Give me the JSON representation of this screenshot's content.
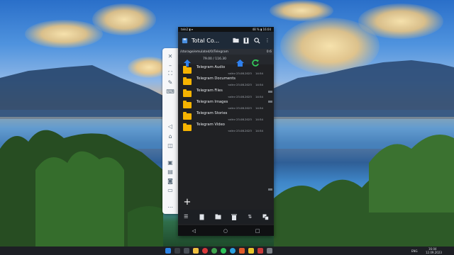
{
  "phone_status": {
    "left": "tele2 ▮ ▾",
    "right": "48 % ▮ 16:04"
  },
  "app": {
    "title": "Total Co...",
    "path": "/storage/emulated/0/Telegram",
    "path_right": "0:6",
    "space_info": "79.00 / 116.30"
  },
  "files": [
    {
      "name": "Telegram Audio",
      "type": "<dir>",
      "date": "23.08.2023",
      "time": "14:54"
    },
    {
      "name": "Telegram Documents",
      "type": "<dir>",
      "date": "23.08.2023",
      "time": "14:54"
    },
    {
      "name": "Telegram Files",
      "type": "<dir>",
      "date": "23.08.2023",
      "time": "14:54"
    },
    {
      "name": "Telegram Images",
      "type": "<dir>",
      "date": "23.08.2023",
      "time": "14:54"
    },
    {
      "name": "Telegram Stories",
      "type": "<dir>",
      "date": "23.08.2023",
      "time": "14:54"
    },
    {
      "name": "Telegram Video",
      "type": "<dir>",
      "date": "23.08.2023",
      "time": "14:54"
    }
  ],
  "taskbar": {
    "lang": "ENG",
    "time": "16:04",
    "date": "12.09.2023"
  },
  "colors": {
    "folder": "#f5b301",
    "header_bg": "#1e2a38",
    "list_bg": "#202124",
    "home_icon": "#2f80ed",
    "refresh_icon": "#34c759"
  },
  "icons": {
    "side_toolbar": [
      "close-icon",
      "minimize-icon",
      "fullscreen-icon",
      "pin-icon",
      "keyboard-icon",
      "volume-icon",
      "home-icon",
      "back-icon",
      "screenshot-icon",
      "record-icon",
      "camera-icon",
      "folder-icon",
      "more-icon"
    ]
  }
}
